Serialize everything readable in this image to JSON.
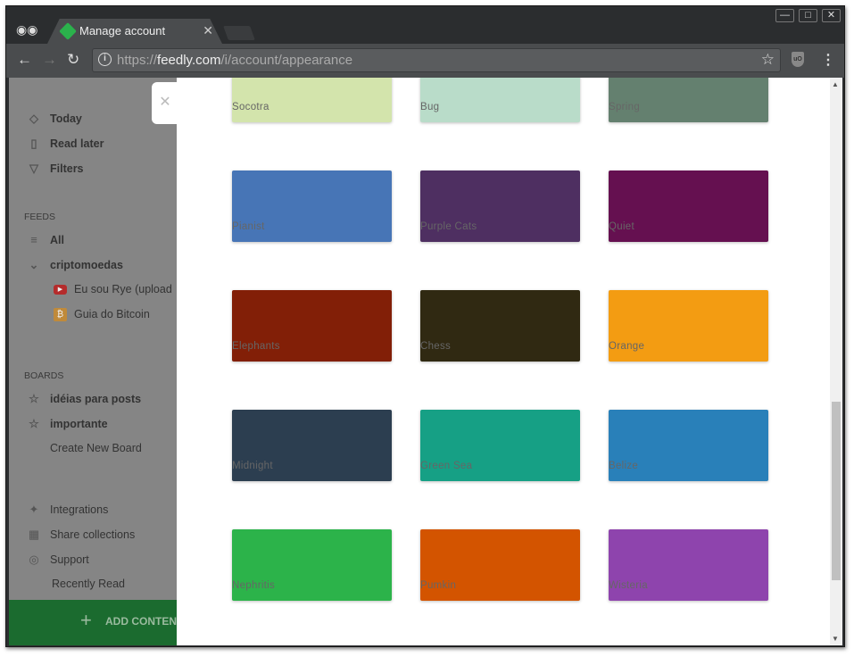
{
  "browser": {
    "tab_title": "Manage account",
    "url_prefix": "https://",
    "url_domain": "feedly.com",
    "url_path": "/i/account/appearance",
    "window_buttons": [
      "minimize",
      "maximize",
      "close"
    ]
  },
  "sidebar": {
    "top": [
      {
        "label": "Today",
        "icon": "feedly-icon"
      },
      {
        "label": "Read later",
        "icon": "bookmark-icon"
      },
      {
        "label": "Filters",
        "icon": "filter-icon"
      }
    ],
    "feeds_heading": "FEEDS",
    "feeds": [
      {
        "label": "All",
        "icon": "list-icon"
      },
      {
        "label": "criptomoedas",
        "icon": "chevron-down-icon"
      }
    ],
    "sources": [
      {
        "label": "Eu sou Rye (upload",
        "icon": "youtube-icon",
        "color": "#b52c2c"
      },
      {
        "label": "Guia do Bitcoin",
        "icon": "bitcoin-icon",
        "color": "#c08a3a"
      }
    ],
    "boards_heading": "BOARDS",
    "boards": [
      {
        "label": "idéias para posts"
      },
      {
        "label": "importante"
      }
    ],
    "create_board": "Create New Board",
    "bottom": [
      {
        "label": "Integrations",
        "icon": "plug-icon"
      },
      {
        "label": "Share collections",
        "icon": "share-icon"
      },
      {
        "label": "Support",
        "icon": "lifebuoy-icon"
      }
    ],
    "recently_read": "Recently Read",
    "add_content": "ADD CONTENT"
  },
  "themes": [
    {
      "name": "Socotra",
      "color": "#d3e4ac"
    },
    {
      "name": "Bug",
      "color": "#b9dcc9"
    },
    {
      "name": "Spring",
      "color": "#64806f"
    },
    {
      "name": "Pianist",
      "color": "#4775b6"
    },
    {
      "name": "Purple Cats",
      "color": "#4e2f61"
    },
    {
      "name": "Quiet",
      "color": "#651050"
    },
    {
      "name": "Elephants",
      "color": "#821f07"
    },
    {
      "name": "Chess",
      "color": "#302912"
    },
    {
      "name": "Orange",
      "color": "#f39c12"
    },
    {
      "name": "Midnight",
      "color": "#2c3e50"
    },
    {
      "name": "Green Sea",
      "color": "#16a085"
    },
    {
      "name": "Belize",
      "color": "#2980b9"
    },
    {
      "name": "Nephritis",
      "color": "#2cb34a"
    },
    {
      "name": "Pumkin",
      "color": "#d35400"
    },
    {
      "name": "Wisteria",
      "color": "#8e44ad"
    }
  ]
}
